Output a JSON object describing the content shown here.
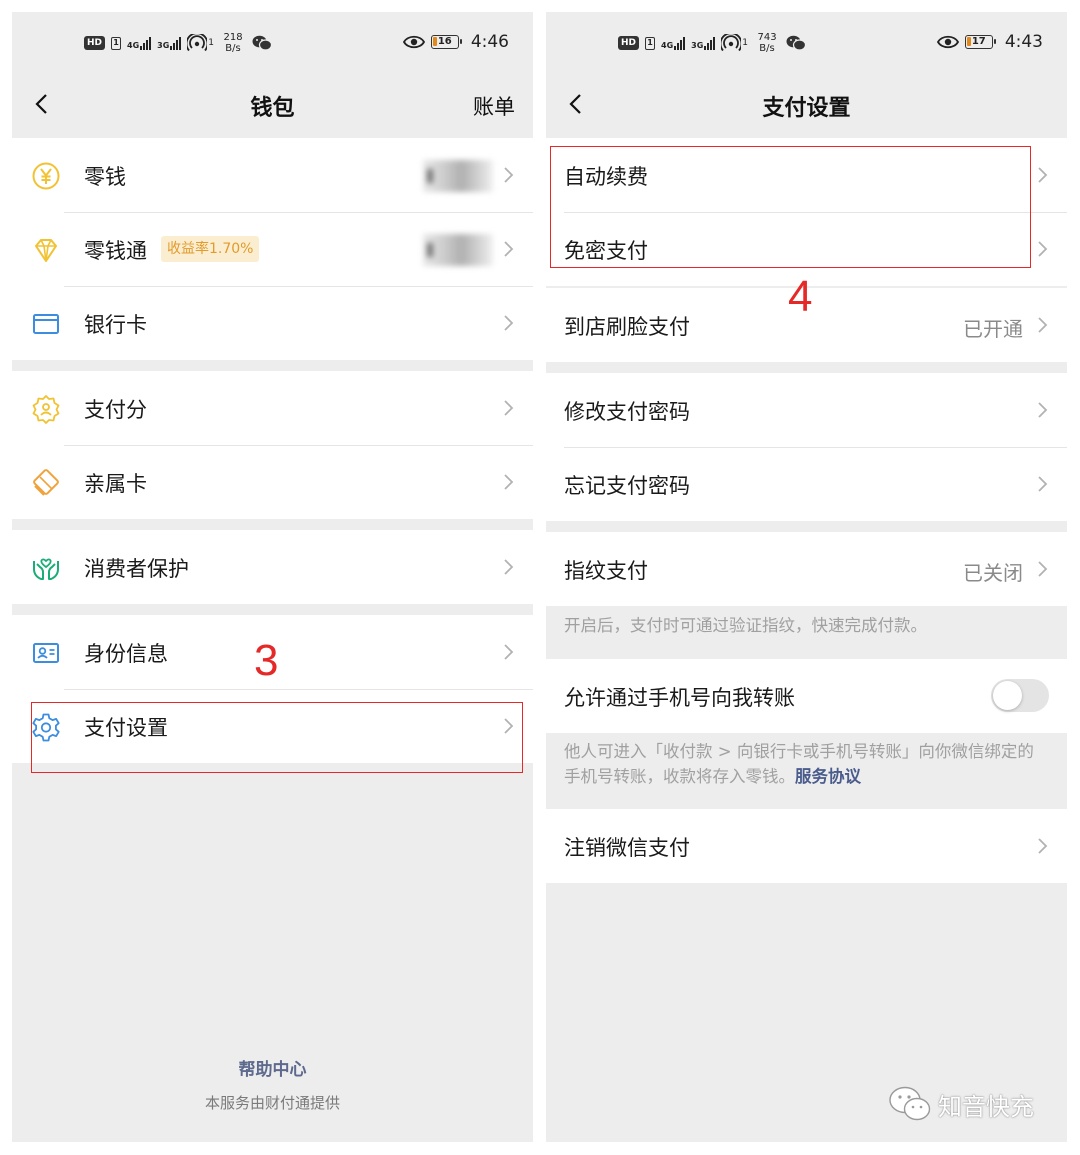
{
  "left_screen": {
    "status_bar": {
      "hd": "HD",
      "sim": "1",
      "net_1": "4G",
      "net_2": "3G",
      "hotspot_sup": "1",
      "speed_value": "218",
      "speed_unit": "B/s",
      "battery": "16",
      "time": "4:46",
      "icons": [
        "wifi-hotspot-icon",
        "wechat-icon",
        "eye-icon"
      ]
    },
    "nav": {
      "title": "钱包",
      "right_action": "账单"
    },
    "groups": [
      [
        {
          "label": "零钱",
          "icon": "yuan-coin-icon"
        },
        {
          "label": "零钱通",
          "icon": "diamond-icon",
          "badge": "收益率1.70%"
        },
        {
          "label": "银行卡",
          "icon": "bank-card-icon"
        }
      ],
      [
        {
          "label": "支付分",
          "icon": "badge-score-icon"
        },
        {
          "label": "亲属卡",
          "icon": "family-card-icon"
        }
      ],
      [
        {
          "label": "消费者保护",
          "icon": "protection-hands-icon"
        }
      ],
      [
        {
          "label": "身份信息",
          "icon": "id-card-icon"
        },
        {
          "label": "支付设置",
          "icon": "gear-icon"
        }
      ]
    ],
    "footer": {
      "help": "帮助中心",
      "note": "本服务由财付通提供"
    },
    "step_number": "3"
  },
  "right_screen": {
    "status_bar": {
      "hd": "HD",
      "sim": "1",
      "net_1": "4G",
      "net_2": "3G",
      "hotspot_sup": "1",
      "speed_value": "743",
      "speed_unit": "B/s",
      "battery": "17",
      "time": "4:43"
    },
    "nav": {
      "title": "支付设置"
    },
    "groups": [
      [
        {
          "label": "自动续费"
        },
        {
          "label": "免密支付"
        }
      ],
      [
        {
          "label": "到店刷脸支付",
          "value": "已开通"
        }
      ],
      [
        {
          "label": "修改支付密码"
        },
        {
          "label": "忘记支付密码"
        }
      ],
      [
        {
          "label": "指纹支付",
          "value": "已关闭"
        }
      ]
    ],
    "fingerprint_desc": "开启后，支付时可通过验证指纹，快速完成付款。",
    "phone_transfer": {
      "label": "允许通过手机号向我转账",
      "enabled": false,
      "desc": "他人可进入「收付款 > 向银行卡或手机号转账」向你微信绑定的手机号转账，收款将存入零钱。",
      "link": "服务协议"
    },
    "deregister": {
      "label": "注销微信支付"
    },
    "step_number": "4"
  },
  "watermark": {
    "text": "知音快充",
    "icon": "wechat-icon"
  },
  "colors": {
    "highlight": "#e52828",
    "page_background": "#ededed",
    "badge_text": "#e29b2c",
    "badge_bg": "#fbeed0",
    "link": "#4a5c8c",
    "icon_yellow": "#f1c232",
    "icon_orange": "#f0a23b",
    "icon_blue": "#3c8de0",
    "icon_green": "#1aad77"
  }
}
